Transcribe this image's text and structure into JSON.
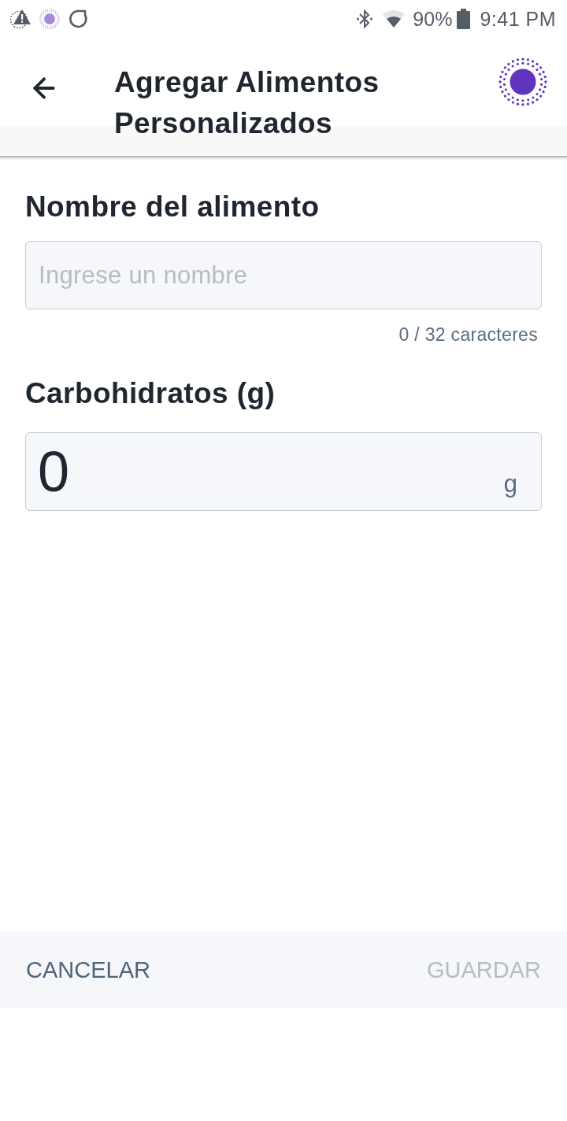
{
  "status_bar": {
    "battery_text": "90%",
    "time": "9:41 PM"
  },
  "header": {
    "title": "Agregar Alimentos Personalizados"
  },
  "fields": [
    {
      "kind": "text",
      "label": "Nombre del alimento",
      "placeholder": "Ingrese un nombre",
      "counter": "0 / 32 caracteres"
    },
    {
      "kind": "number",
      "label": "Carbohidratos (g)",
      "value": "0",
      "unit": "g"
    }
  ],
  "actions": [
    {
      "label": "CANCELAR",
      "disabled": false
    },
    {
      "label": "GUARDAR",
      "disabled": true
    }
  ]
}
